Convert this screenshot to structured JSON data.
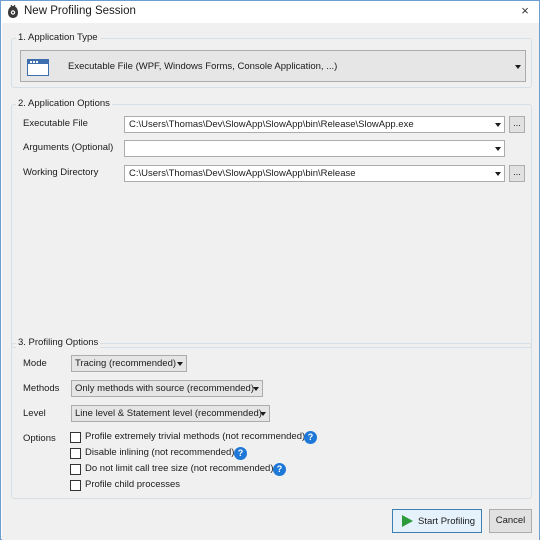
{
  "window": {
    "title": "New Profiling Session",
    "close_glyph": "×"
  },
  "application_type": {
    "legend": "1. Application Type",
    "selected": "Executable File (WPF, Windows Forms, Console Application, ...)",
    "icon": "executable-window-icon"
  },
  "application_options": {
    "legend": "2. Application Options",
    "executable_file": {
      "label": "Executable File",
      "value": "C:\\Users\\Thomas\\Dev\\SlowApp\\SlowApp\\bin\\Release\\SlowApp.exe",
      "browse": "..."
    },
    "arguments": {
      "label": "Arguments (Optional)",
      "value": ""
    },
    "working_directory": {
      "label": "Working Directory",
      "value": "C:\\Users\\Thomas\\Dev\\SlowApp\\SlowApp\\bin\\Release",
      "browse": "..."
    }
  },
  "profiling_options": {
    "legend": "3. Profiling Options",
    "mode": {
      "label": "Mode",
      "value": "Tracing (recommended)"
    },
    "methods": {
      "label": "Methods",
      "value": "Only methods with source (recommended)"
    },
    "level": {
      "label": "Level",
      "value": "Line level & Statement level (recommended)"
    },
    "options_label": "Options",
    "options": [
      {
        "label": "Profile extremely trivial methods (not recommended)",
        "checked": false,
        "help": true
      },
      {
        "label": "Disable inlining (not recommended)",
        "checked": false,
        "help": true
      },
      {
        "label": "Do not limit call tree size (not recommended)",
        "checked": false,
        "help": true
      },
      {
        "label": "Profile child processes",
        "checked": false,
        "help": false
      }
    ],
    "help_glyph": "?"
  },
  "footer": {
    "start_label": "Start Profiling",
    "cancel_label": "Cancel"
  },
  "colors": {
    "accent": "#1e78d7",
    "play": "#2e9a3a",
    "window_border": "#6d9dd1"
  }
}
